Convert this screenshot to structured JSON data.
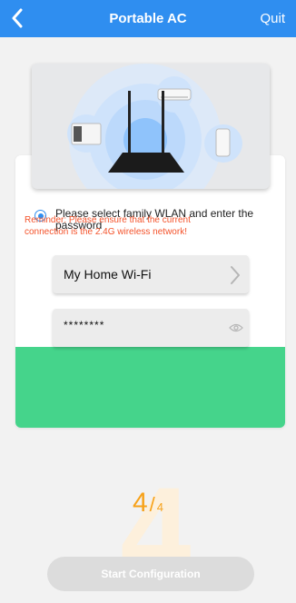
{
  "header": {
    "title": "Portable AC",
    "quit_label": "Quit",
    "back_icon": "chevron-left-icon",
    "background_color": "#2f8ef0"
  },
  "instruction": {
    "text": "Please select family WLAN and enter the password",
    "selected": true
  },
  "wifi": {
    "ssid_value": "My Home Wi-Fi",
    "password_value": "********"
  },
  "reminder": {
    "text": "Reminder: Please ensure that the current connection is the 2.4G wireless network!",
    "color": "#f4522a",
    "background_color": "#45d48b"
  },
  "step": {
    "current": "4",
    "separator": "/",
    "total": "4",
    "color": "#f7a21a"
  },
  "actions": {
    "start_label": "Start Configuration"
  }
}
